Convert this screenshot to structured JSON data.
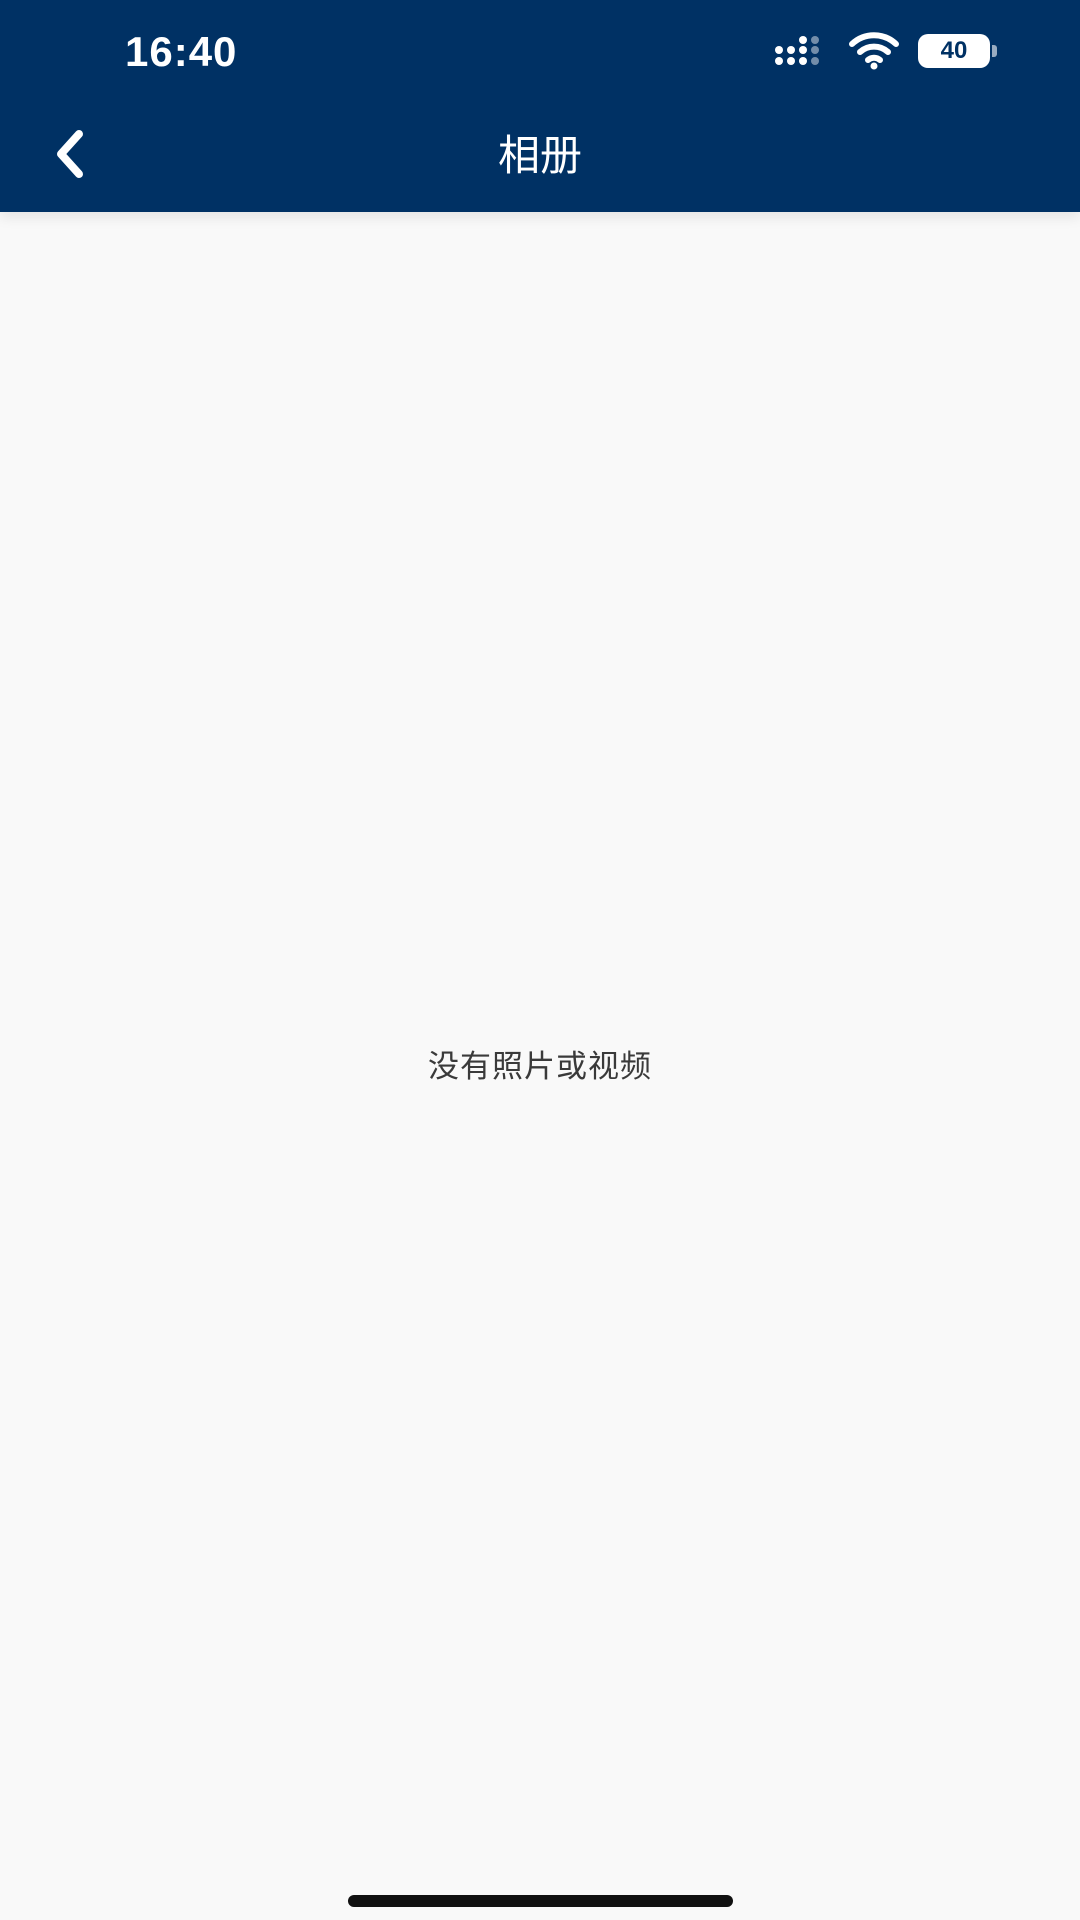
{
  "status_bar": {
    "time": "16:40",
    "battery": "40",
    "icons": [
      "signal-icon",
      "wifi-icon",
      "battery-icon"
    ]
  },
  "nav_bar": {
    "back_icon": "chevron-left-icon",
    "title": "相册"
  },
  "content": {
    "empty_message": "没有照片或视频"
  },
  "colors": {
    "header_bg": "#003164",
    "page_bg": "#f9f9f9",
    "text_primary": "#3a3a3a",
    "header_text": "#ffffff"
  }
}
